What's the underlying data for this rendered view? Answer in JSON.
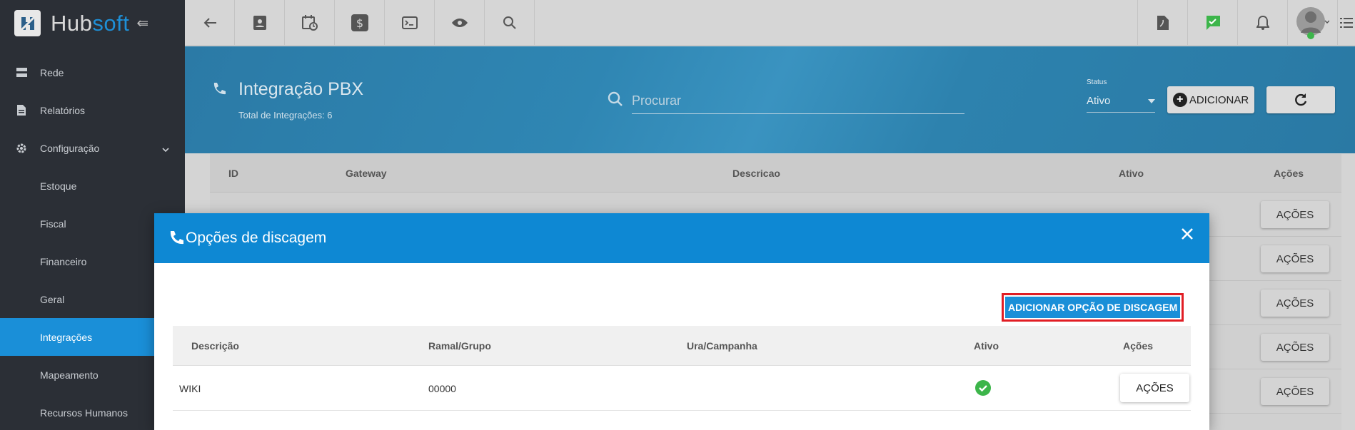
{
  "brand": {
    "name_part1": "Hub",
    "name_part2": "soft"
  },
  "sidebar": {
    "items": [
      {
        "label": "Rede"
      },
      {
        "label": "Relatórios"
      },
      {
        "label": "Configuração"
      },
      {
        "label": "Estoque"
      },
      {
        "label": "Fiscal"
      },
      {
        "label": "Financeiro"
      },
      {
        "label": "Geral"
      },
      {
        "label": "Integrações"
      },
      {
        "label": "Mapeamento"
      },
      {
        "label": "Recursos Humanos"
      }
    ]
  },
  "header": {
    "title": "Integração PBX",
    "subtitle": "Total de Integrações: 6",
    "search_placeholder": "Procurar",
    "status_label": "Status",
    "status_value": "Ativo",
    "add_label": "ADICIONAR"
  },
  "bg_table": {
    "columns": [
      "ID",
      "Gateway",
      "Descricao",
      "Ativo",
      "Ações"
    ],
    "row_action": "AÇÕES",
    "row_count": 5
  },
  "modal": {
    "title": "Opções de discagem",
    "add_option_label": "ADICIONAR OPÇÃO DE DISCAGEM",
    "columns": [
      "Descrição",
      "Ramal/Grupo",
      "Ura/Campanha",
      "Ativo",
      "Ações"
    ],
    "rows": [
      {
        "descricao": "WIKI",
        "ramal": "00000",
        "ura": "",
        "action": "AÇÕES"
      }
    ]
  },
  "colors": {
    "accent": "#1a8fd8",
    "sidebar": "#2b2f36",
    "highlight": "#e11d24",
    "success": "#3cb54a"
  }
}
